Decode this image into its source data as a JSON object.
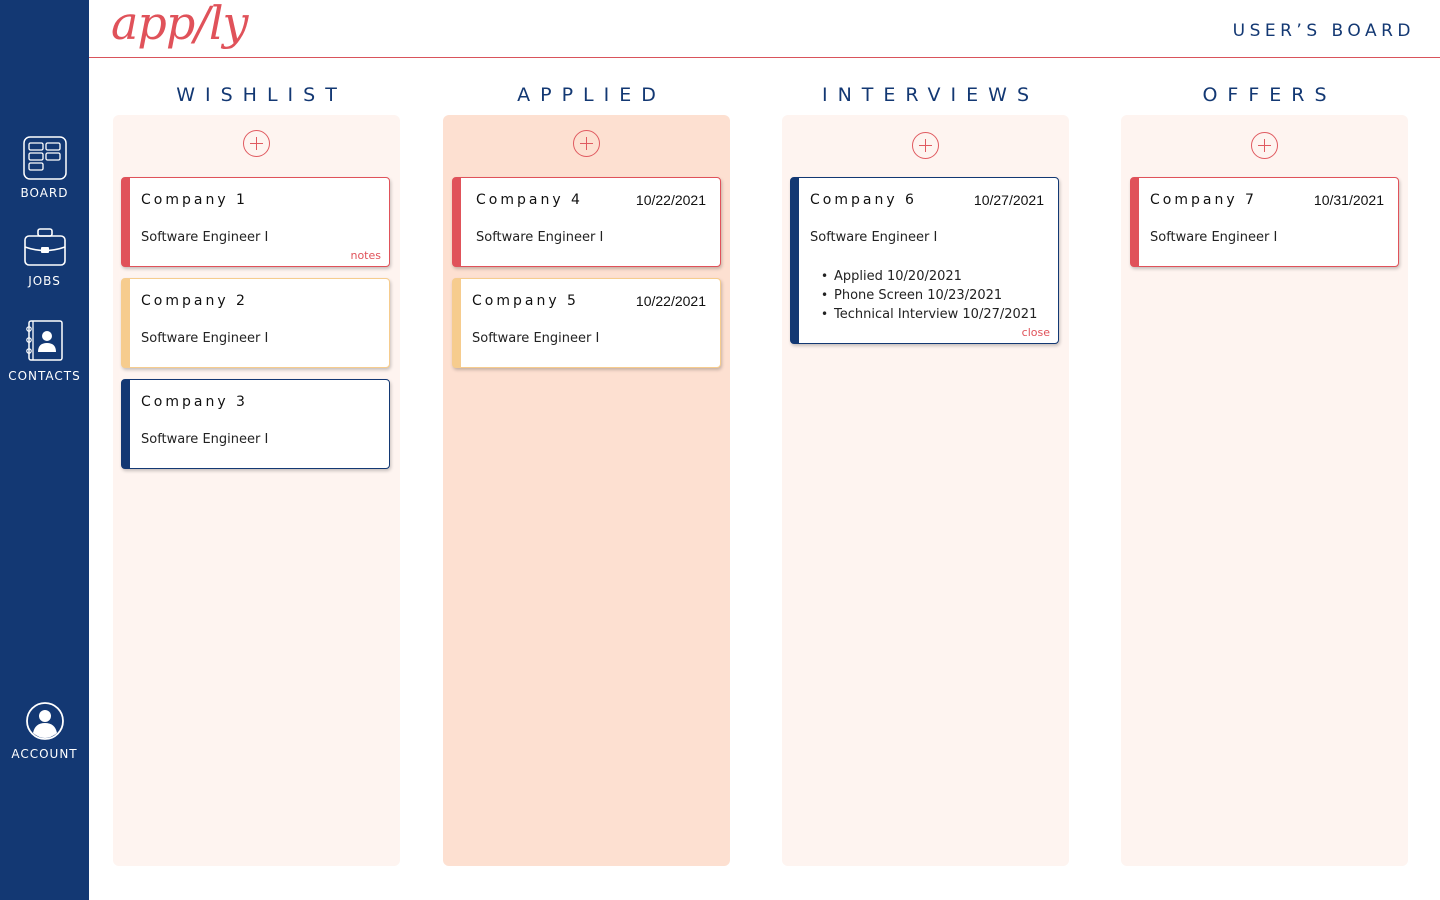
{
  "nav": {
    "board": {
      "label": "BOARD",
      "icon": "board-icon"
    },
    "jobs": {
      "label": "JOBS",
      "icon": "briefcase-icon"
    },
    "contacts": {
      "label": "CONTACTS",
      "icon": "contact-book-icon"
    },
    "account": {
      "label": "ACCOUNT",
      "icon": "user-avatar-icon"
    }
  },
  "header": {
    "logo": "app/ly",
    "board_title": "USER’S BOARD"
  },
  "colors": {
    "sidebar": "#133873",
    "accent": "#e0525a",
    "column_light": "#fef4f0",
    "column_dark": "#fde0d1",
    "card_red": "#e0525a",
    "card_yellow": "#f6cc8e",
    "card_navy": "#133873"
  },
  "columns": [
    {
      "title": "WISHLIST",
      "cards": [
        {
          "company": "Company 1",
          "role": "Software Engineer I",
          "link": "notes",
          "color": "red"
        },
        {
          "company": "Company 2",
          "role": "Software Engineer I",
          "color": "yellow"
        },
        {
          "company": "Company 3",
          "role": "Software Engineer I",
          "color": "navy"
        }
      ]
    },
    {
      "title": "APPLIED",
      "cards": [
        {
          "company": "Company 4",
          "date": "10/22/2021",
          "role": "Software Engineer I",
          "color": "red"
        },
        {
          "company": "Company 5",
          "date": "10/22/2021",
          "role": "Software Engineer I",
          "color": "yellow"
        }
      ]
    },
    {
      "title": "INTERVIEWS",
      "cards": [
        {
          "company": "Company 6",
          "date": "10/27/2021",
          "role": "Software Engineer I",
          "color": "navy",
          "timeline": [
            "Applied 10/20/2021",
            "Phone Screen 10/23/2021",
            "Technical Interview 10/27/2021"
          ],
          "link": "close"
        }
      ]
    },
    {
      "title": "OFFERS",
      "cards": [
        {
          "company": "Company 7",
          "date": "10/31/2021",
          "role": "Software Engineer I",
          "color": "red"
        }
      ]
    }
  ]
}
